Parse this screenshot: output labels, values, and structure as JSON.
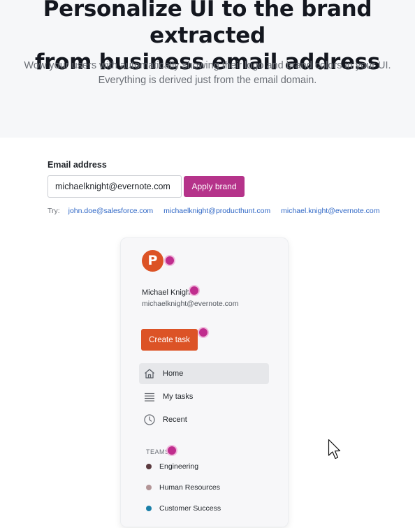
{
  "hero": {
    "title": "Personalize UI to the brand extracted\nfrom business email address",
    "subtitle": "Wow your users with automatically showing their logo and brand colors in your UI. Everything is derived just from the email domain."
  },
  "form": {
    "label": "Email address",
    "value": "michaelknight@evernote.com",
    "button": "Apply brand",
    "try_label": "Try:",
    "suggestions": [
      "john.doe@salesforce.com",
      "michaelknight@producthunt.com",
      "michael.knight@evernote.com"
    ]
  },
  "preview": {
    "logo_letter": "P",
    "user_name": "Michael Knight",
    "user_email": "michaelknight@evernote.com",
    "create_button": "Create task",
    "nav": [
      {
        "label": "Home",
        "icon": "home-icon",
        "active": true
      },
      {
        "label": "My tasks",
        "icon": "list-icon",
        "active": false
      },
      {
        "label": "Recent",
        "icon": "clock-icon",
        "active": false
      }
    ],
    "teams_header": "TEAMS",
    "teams": [
      {
        "label": "Engineering",
        "color": "#5b3a3f"
      },
      {
        "label": "Human Resources",
        "color": "#b39597"
      },
      {
        "label": "Customer Success",
        "color": "#1a7fa8"
      }
    ]
  },
  "colors": {
    "brand_accent": "#dc5326",
    "apply_button": "#b5338a",
    "highlight_dot": "#c02d8e",
    "link": "#2f67c6"
  }
}
